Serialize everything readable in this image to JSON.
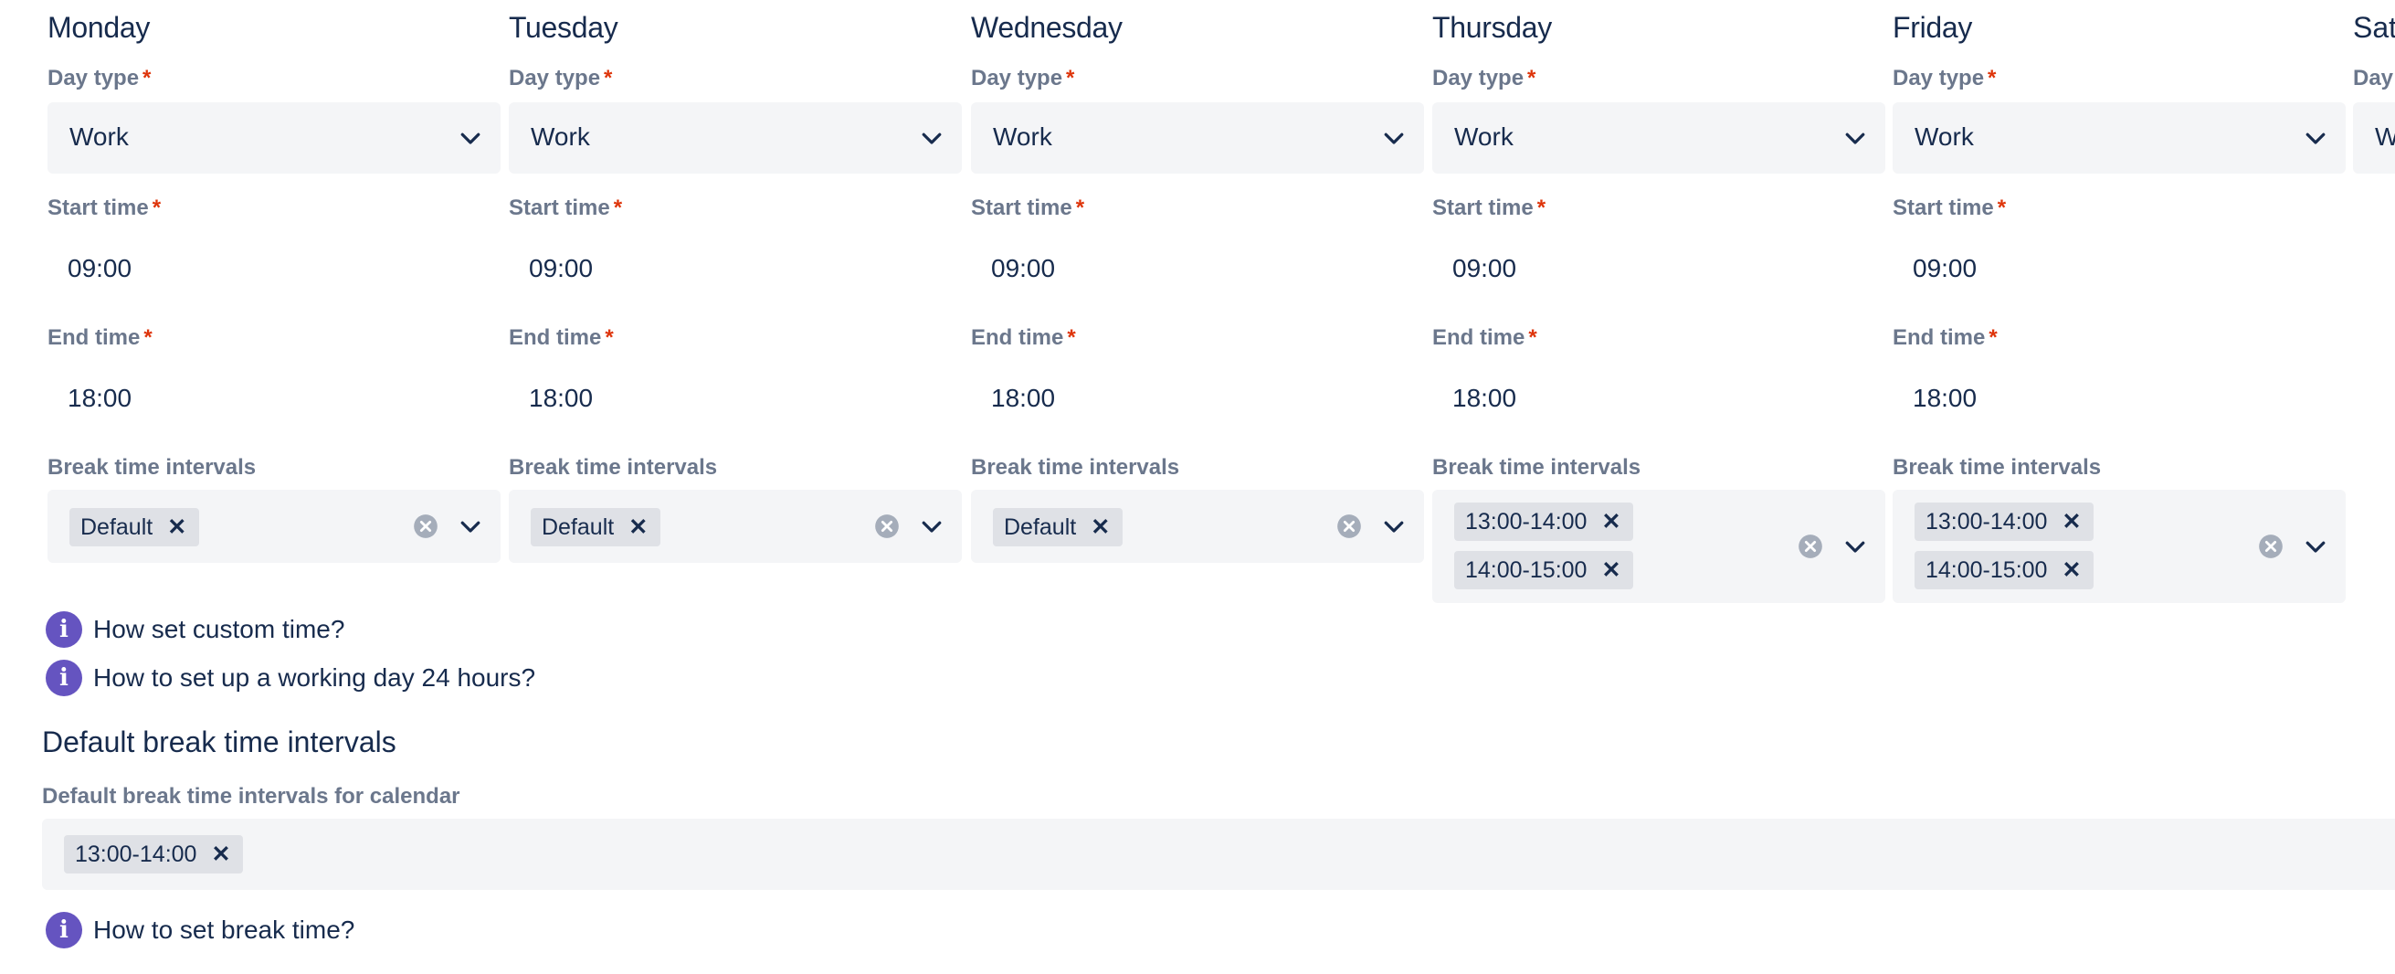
{
  "labels": {
    "day_type": "Day type",
    "start_time": "Start time",
    "end_time": "End time",
    "break_intervals": "Break time intervals",
    "required_mark": "*"
  },
  "days": [
    {
      "name": "Monday",
      "day_type": "Work",
      "start": "09:00",
      "end": "18:00",
      "breaks": [
        "Default"
      ]
    },
    {
      "name": "Tuesday",
      "day_type": "Work",
      "start": "09:00",
      "end": "18:00",
      "breaks": [
        "Default"
      ]
    },
    {
      "name": "Wednesday",
      "day_type": "Work",
      "start": "09:00",
      "end": "18:00",
      "breaks": [
        "Default"
      ]
    },
    {
      "name": "Thursday",
      "day_type": "Work",
      "start": "09:00",
      "end": "18:00",
      "breaks": [
        "13:00-14:00",
        "14:00-15:00"
      ]
    },
    {
      "name": "Friday",
      "day_type": "Work",
      "start": "09:00",
      "end": "18:00",
      "breaks": [
        "13:00-14:00",
        "14:00-15:00"
      ]
    }
  ],
  "saturday": {
    "name": "Sat",
    "day_type_label": "Day",
    "day_type": "W"
  },
  "help": {
    "custom_time": "How set custom time?",
    "working_day_24h": "How to set up a working day 24 hours?",
    "break_time": "How to set break time?",
    "icon_glyph": "i"
  },
  "default_breaks": {
    "title": "Default break time intervals",
    "label": "Default break time intervals for calendar",
    "chips": [
      "13:00-14:00"
    ]
  },
  "chip_remove_glyph": "✕",
  "colors": {
    "accent": "#6554c0",
    "required": "#de350b",
    "field_bg": "#f4f5f7",
    "chip_bg": "#dfe1e6",
    "text": "#172b4d",
    "label": "#6b778c"
  }
}
